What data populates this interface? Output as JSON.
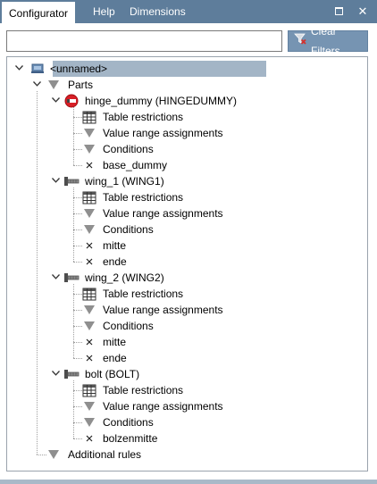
{
  "tabs": [
    {
      "label": "Configurator"
    },
    {
      "label": "Help"
    },
    {
      "label": "Dimensions"
    }
  ],
  "window": {
    "maximize_icon": "maximize-icon",
    "close_symbol": "✕"
  },
  "filter": {
    "value": "",
    "placeholder": "",
    "clear_label": "Clear Filters"
  },
  "colors": {
    "titlebar": "#5e7d9b",
    "button": "#7694b2",
    "selection": "#a3b5c6"
  },
  "tree": {
    "root": {
      "label": "<unnamed>"
    },
    "parts": {
      "label": "Parts"
    },
    "items": [
      {
        "label": "hinge_dummy (HINGEDUMMY)",
        "icon": "blocked-part-icon",
        "children": [
          {
            "label": "Table restrictions",
            "icon": "table-icon"
          },
          {
            "label": "Value range assignments",
            "icon": "funnel-icon"
          },
          {
            "label": "Conditions",
            "icon": "funnel-icon"
          },
          {
            "label": "base_dummy",
            "icon": "x-icon"
          }
        ]
      },
      {
        "label": "wing_1 (WING1)",
        "icon": "part-icon",
        "children": [
          {
            "label": "Table restrictions",
            "icon": "table-icon"
          },
          {
            "label": "Value range assignments",
            "icon": "funnel-icon"
          },
          {
            "label": "Conditions",
            "icon": "funnel-icon"
          },
          {
            "label": "mitte",
            "icon": "x-icon"
          },
          {
            "label": "ende",
            "icon": "x-icon"
          }
        ]
      },
      {
        "label": "wing_2 (WING2)",
        "icon": "part-icon",
        "children": [
          {
            "label": "Table restrictions",
            "icon": "table-icon"
          },
          {
            "label": "Value range assignments",
            "icon": "funnel-icon"
          },
          {
            "label": "Conditions",
            "icon": "funnel-icon"
          },
          {
            "label": "mitte",
            "icon": "x-icon"
          },
          {
            "label": "ende",
            "icon": "x-icon"
          }
        ]
      },
      {
        "label": "bolt (BOLT)",
        "icon": "part-icon",
        "children": [
          {
            "label": "Table restrictions",
            "icon": "table-icon"
          },
          {
            "label": "Value range assignments",
            "icon": "funnel-icon"
          },
          {
            "label": "Conditions",
            "icon": "funnel-icon"
          },
          {
            "label": "bolzenmitte",
            "icon": "x-icon"
          }
        ]
      }
    ],
    "additional": {
      "label": "Additional rules"
    }
  }
}
